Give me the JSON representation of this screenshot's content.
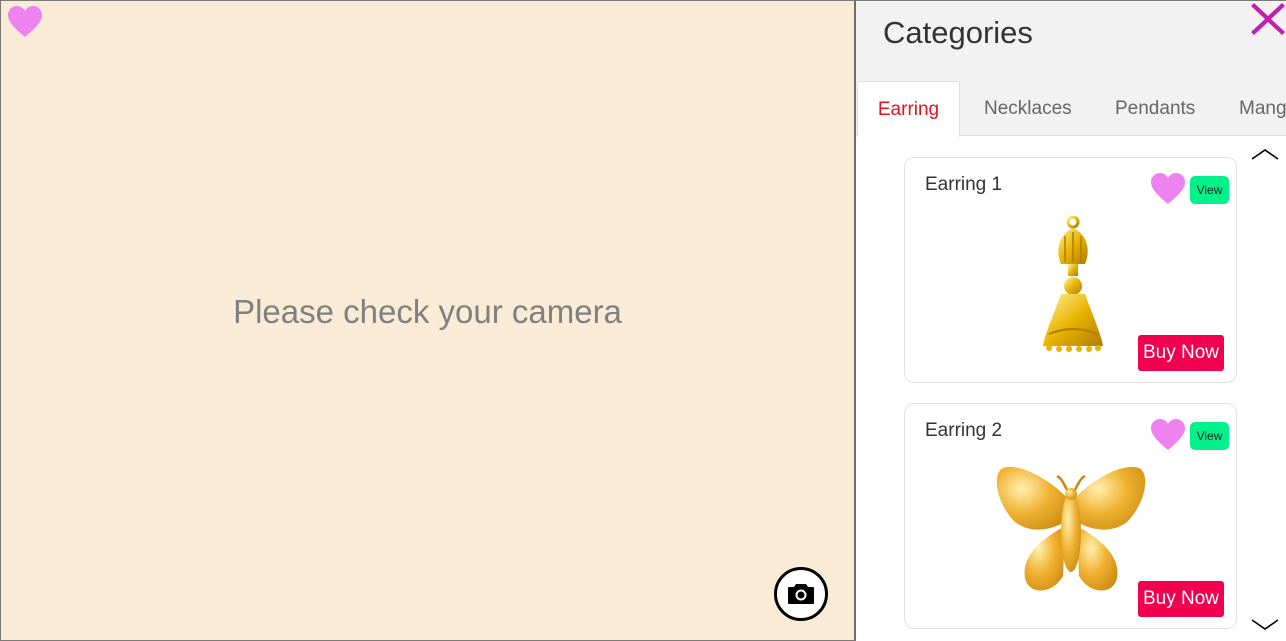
{
  "camera": {
    "message": "Please check your camera",
    "favorite_icon": "heart-icon",
    "capture_icon": "camera-icon"
  },
  "panel": {
    "title": "Categories",
    "close_icon": "close-icon",
    "tabs": [
      {
        "label": "Earring",
        "active": true
      },
      {
        "label": "Necklaces",
        "active": false
      },
      {
        "label": "Pendants",
        "active": false
      },
      {
        "label": "Mang",
        "active": false
      }
    ],
    "products": [
      {
        "title": "Earring 1",
        "view_label": "View",
        "buy_label": "Buy Now",
        "image": "gold-jhumka-earring"
      },
      {
        "title": "Earring 2",
        "view_label": "View",
        "buy_label": "Buy Now",
        "image": "gold-butterfly-earring"
      }
    ]
  },
  "colors": {
    "camera_bg": "#faebd7",
    "heart": "#ee82ee",
    "close": "#c020b0",
    "active_tab": "#e0141e",
    "view_button": "#00f08a",
    "buy_button": "#f0004f"
  }
}
